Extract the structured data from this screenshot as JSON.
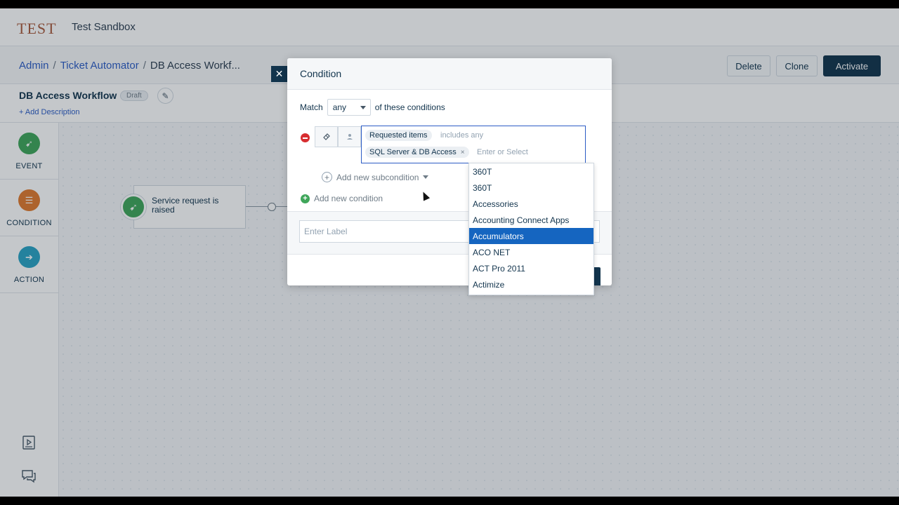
{
  "header": {
    "logo": "TEST",
    "sandbox": "Test Sandbox"
  },
  "breadcrumb": {
    "items": [
      "Admin",
      "Ticket Automator"
    ],
    "current": "DB Access Workf..."
  },
  "actions": {
    "delete": "Delete",
    "clone": "Clone",
    "activate": "Activate"
  },
  "workflow": {
    "title": "DB Access Workflow",
    "status": "Draft",
    "add_description": "+ Add Description"
  },
  "rail": {
    "event": "EVENT",
    "condition": "CONDITION",
    "action": "ACTION"
  },
  "canvas": {
    "node_text": "Service request is raised"
  },
  "modal": {
    "title": "Condition",
    "match_prefix": "Match",
    "match_value": "any",
    "match_suffix": "of these conditions",
    "condition": {
      "field": "Requested items",
      "operator": "includes any",
      "selected_value": "SQL Server & DB Access",
      "remove_symbol": "×",
      "placeholder": "Enter or Select"
    },
    "add_subcondition": "Add new subcondition",
    "add_condition": "Add new condition",
    "label_placeholder": "Enter Label"
  },
  "dropdown": {
    "options": [
      "360T",
      "360T",
      "Accessories",
      "Accounting Connect Apps",
      "Accumulators",
      "ACO NET",
      "ACT Pro 2011",
      "Actimize"
    ],
    "highlighted": "Accumulators"
  },
  "colors": {
    "primary_dark": "#12344d",
    "link": "#2c5cc5",
    "event_green": "#3fa65a",
    "condition_orange": "#e07a2e",
    "action_teal": "#2aa3c5",
    "highlight": "#1565c0"
  }
}
